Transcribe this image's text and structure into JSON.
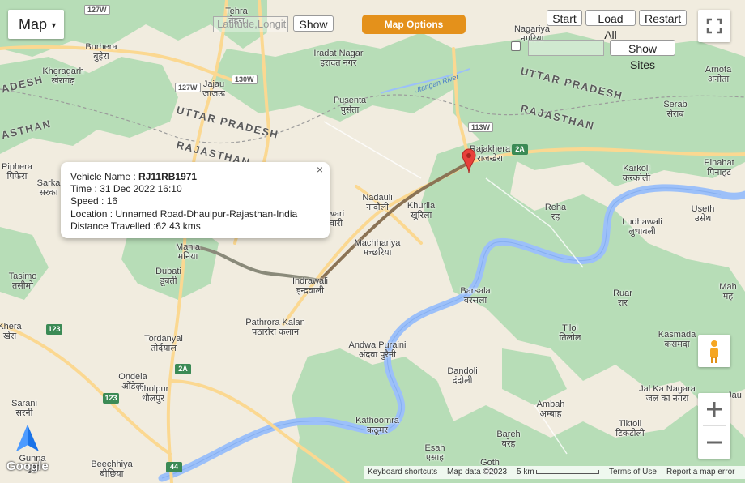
{
  "map_type": {
    "label": "Map"
  },
  "search": {
    "placeholder": "Latitude,Longit",
    "show_label": "Show"
  },
  "map_options": {
    "label": "Map Options"
  },
  "playback": {
    "start": "Start",
    "load_all": "Load All",
    "restart": "Restart"
  },
  "sites": {
    "show_label": "Show Sites"
  },
  "info_window": {
    "vehicle_name_label": "Vehicle Name : ",
    "vehicle_name": "RJ11RB1971",
    "time": "Time : 31 Dec 2022 16:10",
    "speed": "Speed : 16",
    "location": "Location : Unnamed Road-Dhaulpur-Rajasthan-India",
    "distance": "Distance Travelled :62.43 kms",
    "close": "×"
  },
  "states": {
    "up_right": "UTTAR PRADESH",
    "rj_right": "RAJASTHAN",
    "up_left": "UTTAR PRADESH",
    "rj_left": "RAJASTHAN",
    "desh": "ADESH",
    "sthan": "ASTHAN"
  },
  "river": "Utangan River",
  "places": [
    {
      "en": "Tehra",
      "hi": "तेहरा"
    },
    {
      "en": "Burhera",
      "hi": "बुहेरा"
    },
    {
      "en": "Kheragarh",
      "hi": "खेरागढ़"
    },
    {
      "en": "Jajau",
      "hi": "जाजऊ"
    },
    {
      "en": "Iradat Nagar",
      "hi": "इरादत नगर"
    },
    {
      "en": "Pusenta",
      "hi": "पुसेंता"
    },
    {
      "en": "Nagariya",
      "hi": "नगरिया"
    },
    {
      "en": "Arnota",
      "hi": "अनोता"
    },
    {
      "en": "Serab",
      "hi": "सेराब"
    },
    {
      "en": "Rajakhera",
      "hi": "राजखेरा"
    },
    {
      "en": "Pinahat",
      "hi": "पिनाहट"
    },
    {
      "en": "Karkoli",
      "hi": "करकोली"
    },
    {
      "en": "Piphera",
      "hi": "पिफेरा"
    },
    {
      "en": "Sarka",
      "hi": "सरका"
    },
    {
      "en": "Nadauli",
      "hi": "नादौली"
    },
    {
      "en": "Khurila",
      "hi": "खुरिला"
    },
    {
      "en": "Reha",
      "hi": "रह"
    },
    {
      "en": "Useth",
      "hi": "उसेथ"
    },
    {
      "en": "Ludhawali",
      "hi": "लुधावली"
    },
    {
      "en": "wari",
      "hi": "वारी"
    },
    {
      "en": "Machhariya",
      "hi": "मच्छरिया"
    },
    {
      "en": "Mania",
      "hi": "मनिया"
    },
    {
      "en": "Dubati",
      "hi": "डूबती"
    },
    {
      "en": "Indrawali",
      "hi": "इन्द्रवाली"
    },
    {
      "en": "Tasimo",
      "hi": "तसीमो"
    },
    {
      "en": "Barsala",
      "hi": "बरसला"
    },
    {
      "en": "Ruar",
      "hi": "रार"
    },
    {
      "en": "Mah",
      "hi": "मह"
    },
    {
      "en": "Pathrora Kalan",
      "hi": "पठारोरा कलान"
    },
    {
      "en": "Tilol",
      "hi": "तिलोल"
    },
    {
      "en": "Kasmada",
      "hi": "कसमदा"
    },
    {
      "en": "Khera",
      "hi": "खेरा"
    },
    {
      "en": "Tordanyal",
      "hi": "तोर्दयाल"
    },
    {
      "en": "Andwa Puraini",
      "hi": "अंदवा पुरैनी"
    },
    {
      "en": "Dandoli",
      "hi": "दंदोली"
    },
    {
      "en": "Ondela",
      "hi": "ओंडेला"
    },
    {
      "en": "Jal Ka Nagara",
      "hi": "जल का नगरा"
    },
    {
      "en": "Sarani",
      "hi": "सरनी"
    },
    {
      "en": "Dholpur",
      "hi": "धौलपुर"
    },
    {
      "en": "Ambah",
      "hi": "अम्बाह"
    },
    {
      "en": "Kathoomra",
      "hi": "कठूमर"
    },
    {
      "en": "Tiktoli",
      "hi": "टिकटोली"
    },
    {
      "en": "Bareh",
      "hi": "बरेह"
    },
    {
      "en": "Esah",
      "hi": "एसाह"
    },
    {
      "en": "Gunna",
      "hi": "गुन्ना"
    },
    {
      "en": "Beechhiya",
      "hi": "बीछिया"
    },
    {
      "en": "Goth",
      "hi": "गोठ"
    },
    {
      "en": "Jau",
      "hi": ""
    }
  ],
  "shields": [
    "127W",
    "127W",
    "130W",
    "113W",
    "2A",
    "123",
    "2A",
    "123",
    "44",
    "113W"
  ],
  "footer": {
    "logo": "Google",
    "shortcuts": "Keyboard shortcuts",
    "data": "Map data ©2023",
    "scale": "5 km",
    "terms": "Terms of Use",
    "report": "Report a map error"
  },
  "colors": {
    "land": "#f1ecdf",
    "forest": "#b7ddb7",
    "water": "#9cc0f9",
    "road": "#fbd891",
    "options_button": "#e4911b",
    "track_gray": "#8a8a7a",
    "track_brown": "#8b7355",
    "marker": "#e8403a"
  }
}
